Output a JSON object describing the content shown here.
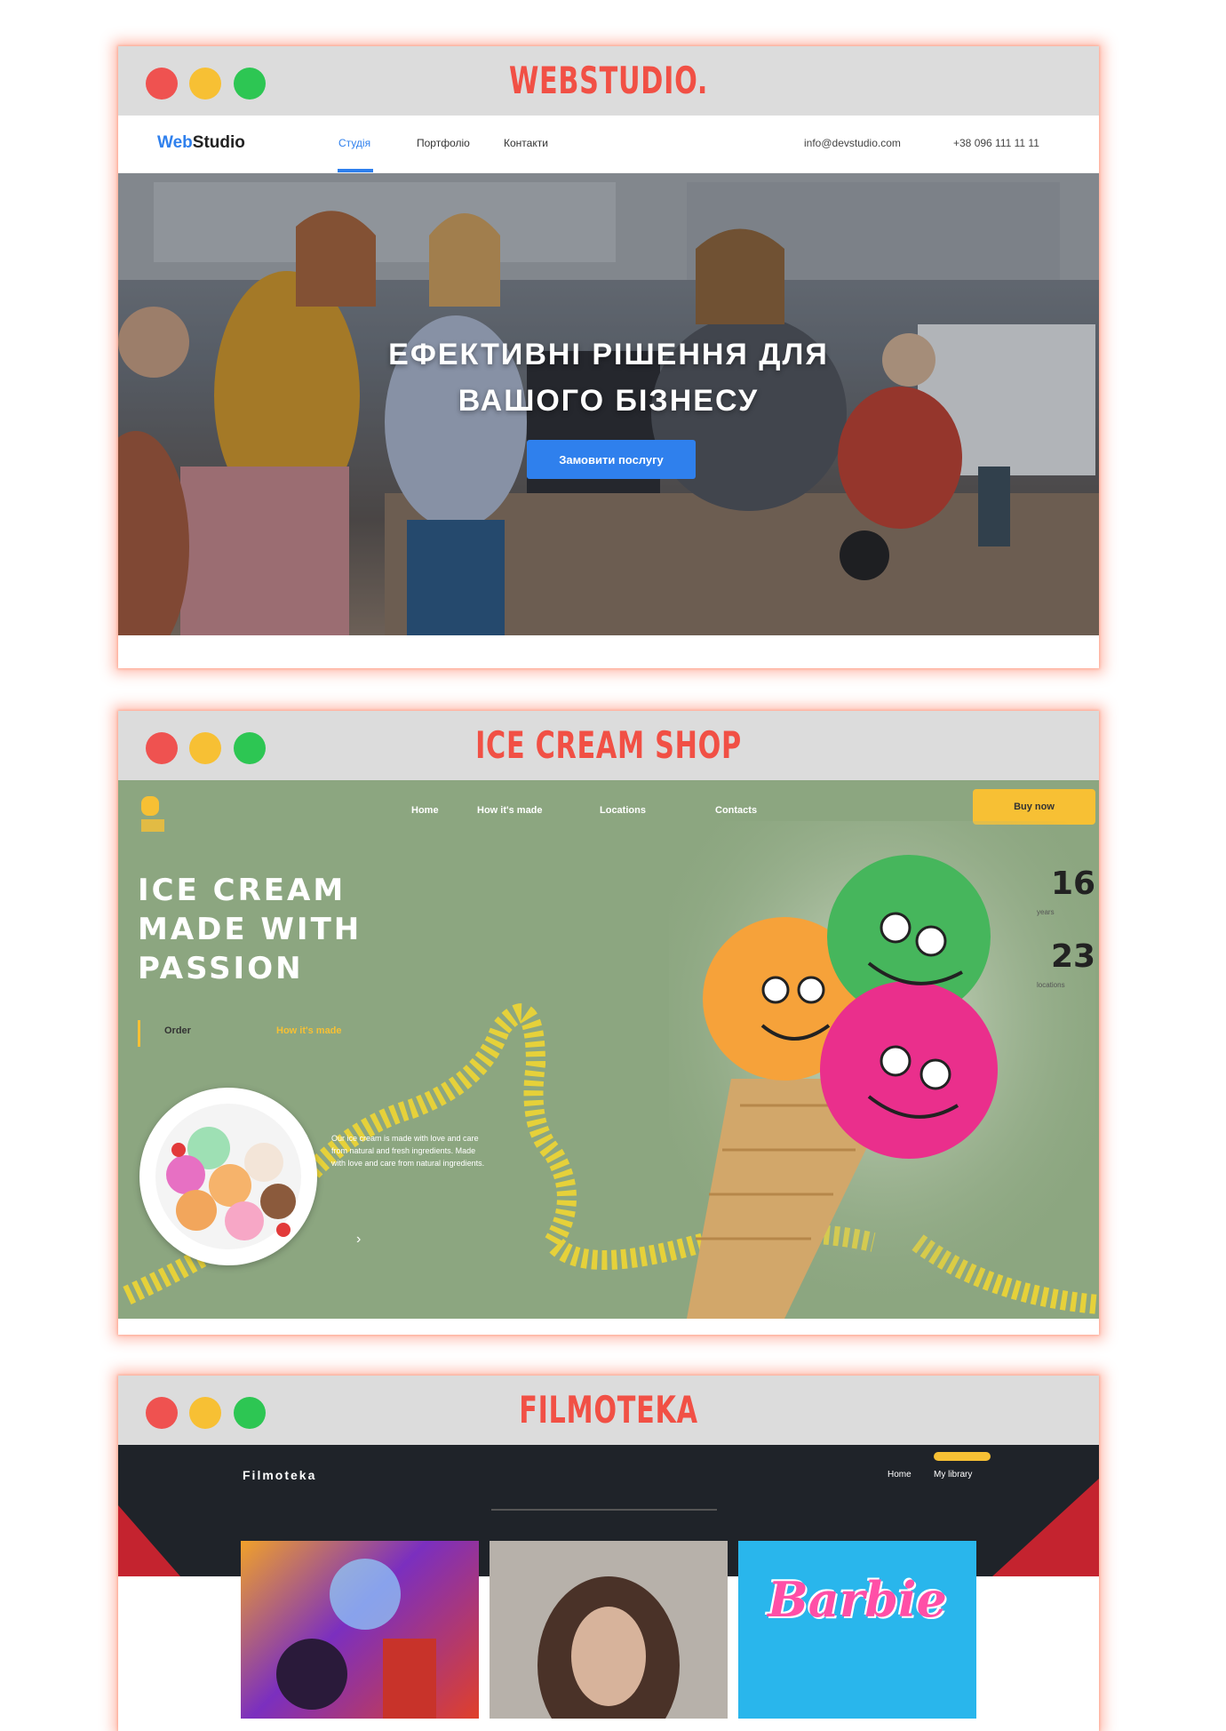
{
  "windows": [
    {
      "title": "WEBSTUDIO.",
      "site": {
        "logo_accent": "Web",
        "logo_rest": "Studio",
        "nav": [
          "Студія",
          "Портфоліо",
          "Контакти"
        ],
        "contacts": [
          "info@devstudio.com",
          "+38 096 111 11 11"
        ],
        "hero_title_line1": "ЕФЕКТИВНІ РІШЕННЯ ДЛЯ",
        "hero_title_line2": "ВАШОГО БІЗНЕСУ",
        "hero_button": "Замовити послугу"
      }
    },
    {
      "title": "ICE CREAM SHOP",
      "site": {
        "menu": [
          "Home",
          "How it's made",
          "Locations",
          "Contacts"
        ],
        "cta": "Buy now",
        "headline": [
          "ICE CREAM",
          "MADE WITH",
          "PASSION"
        ],
        "order_link": "Order",
        "how_link": "How it's made",
        "stats": [
          {
            "value": "16",
            "label": "years"
          },
          {
            "value": "23",
            "label": "locations"
          }
        ],
        "description": "Our ice cream is made with love and care from natural and fresh ingredients. Made with love and care from natural ingredients."
      }
    },
    {
      "title": "FILMOTEKA",
      "site": {
        "logo": "Filmoteka",
        "nav": [
          "Home",
          "My library"
        ],
        "poster_title": "Barbie"
      }
    }
  ],
  "colors": {
    "title_red": "#f15045",
    "webstudio_blue": "#2f80ed",
    "icecream_green": "#8ca680",
    "icecream_yellow": "#f7c034",
    "filmoteka_dark": "#1f2329",
    "filmoteka_red": "#c4232f",
    "barbie_blue": "#29b6ec",
    "barbie_pink": "#ff4fa7"
  }
}
